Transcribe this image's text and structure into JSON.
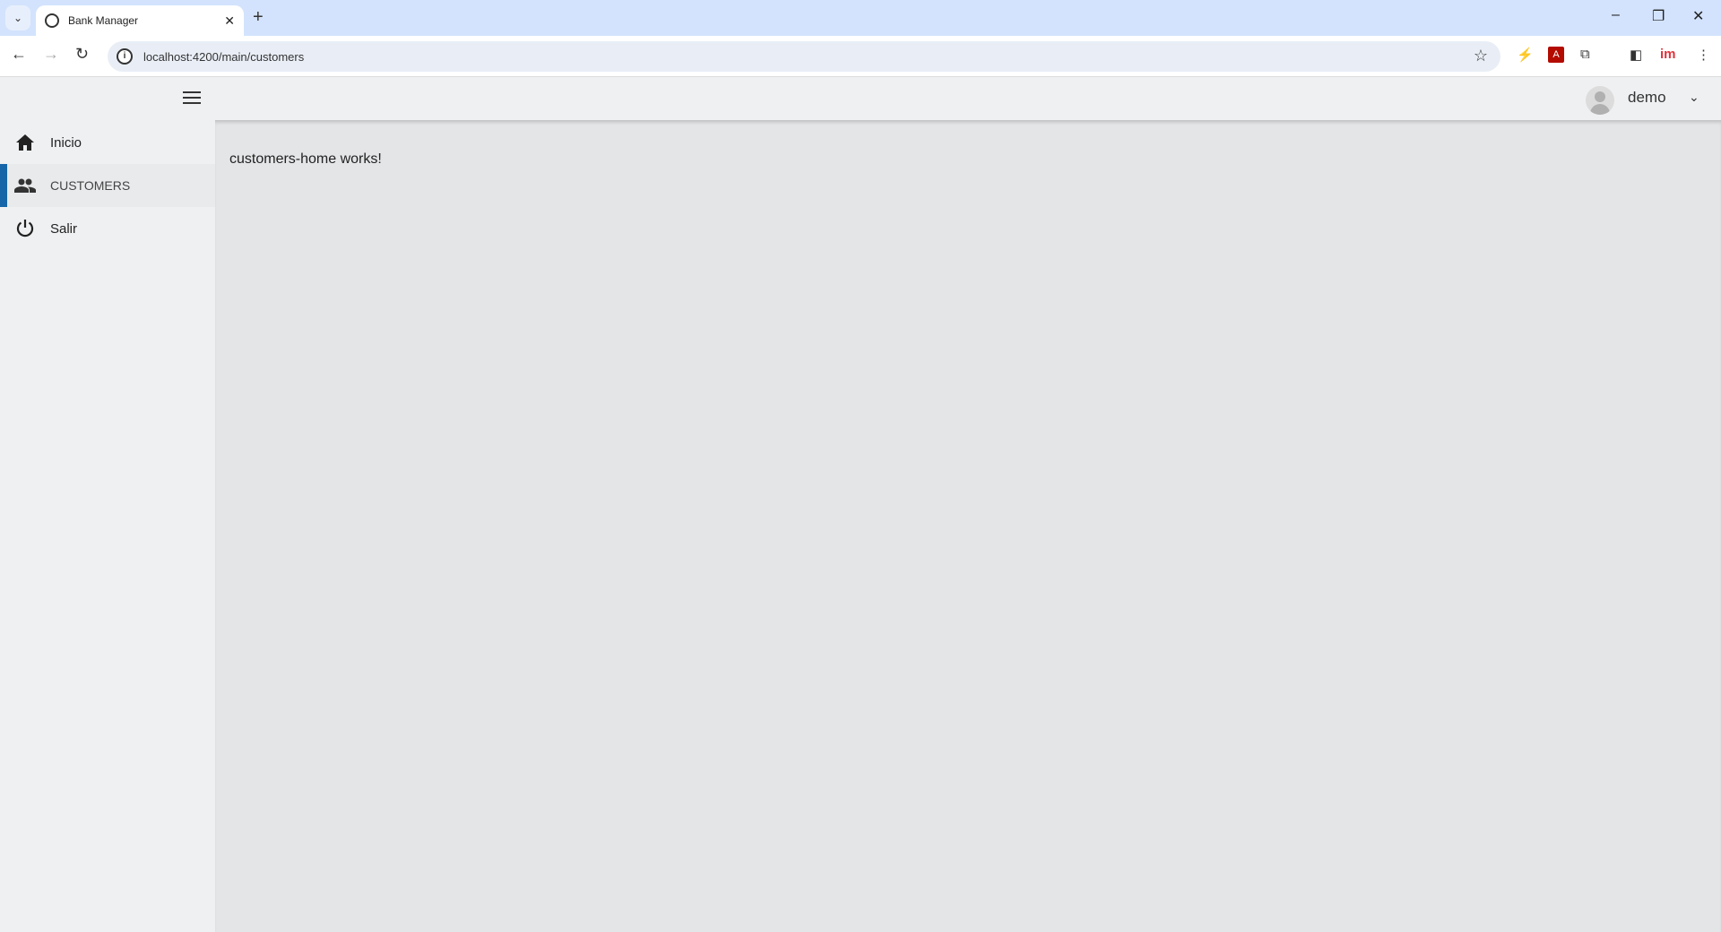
{
  "browser": {
    "tab_title": "Bank Manager",
    "url": "localhost:4200/main/customers"
  },
  "header": {
    "user": "demo"
  },
  "sidebar": {
    "items": [
      {
        "label": "Inicio",
        "icon": "home-icon"
      },
      {
        "label": "CUSTOMERS",
        "icon": "people-icon",
        "active": true
      },
      {
        "label": "Salir",
        "icon": "power-icon"
      }
    ]
  },
  "main": {
    "message": "customers-home works!"
  },
  "colors": {
    "accent": "#1565a8",
    "sidebar_bg": "#eff0f2",
    "content_bg": "#e4e5e7"
  }
}
